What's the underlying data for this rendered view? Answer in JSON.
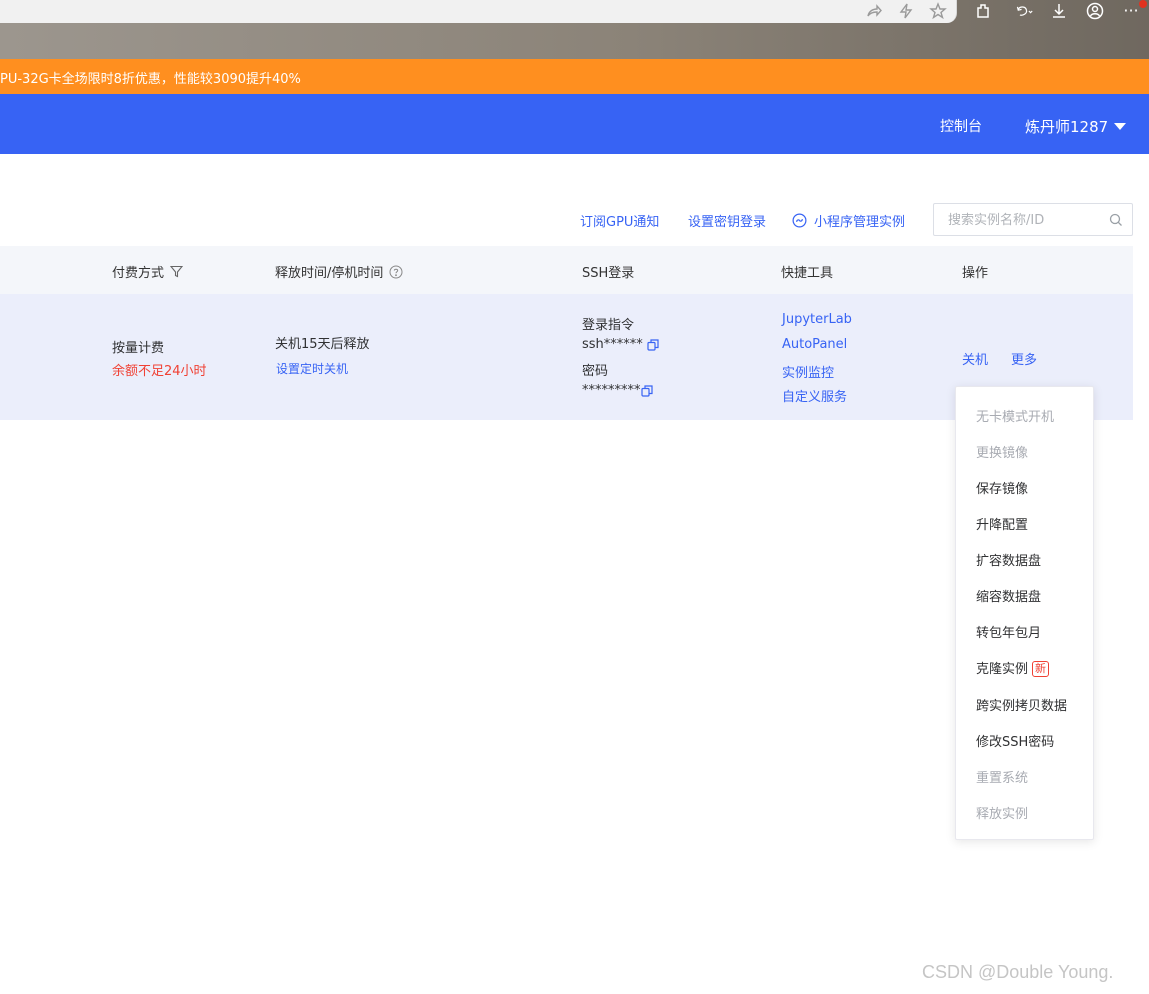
{
  "browser": {
    "icons": [
      "share-icon",
      "bolt-icon",
      "star-icon",
      "extensions-icon",
      "undo-icon",
      "download-icon",
      "profile-icon",
      "more-icon"
    ],
    "more_label": "···"
  },
  "promo": {
    "text": "PU-32G卡全场限时8折优惠，性能较3090提升40%"
  },
  "header": {
    "console": "控制台",
    "user": "炼丹师1287"
  },
  "toolbar": {
    "subscribe": "订阅GPU通知",
    "ssh_key": "设置密钥登录",
    "miniprogram": "小程序管理实例",
    "search_placeholder": "搜索实例名称/ID"
  },
  "table": {
    "headers": {
      "billing": "付费方式",
      "release": "释放时间/停机时间",
      "ssh": "SSH登录",
      "tools": "快捷工具",
      "ops": "操作"
    },
    "row": {
      "billing_mode": "按量计费",
      "billing_warning": "余额不足24小时",
      "release_text": "关机15天后释放",
      "release_link": "设置定时关机",
      "ssh_cmd_label": "登录指令",
      "ssh_cmd": "ssh******",
      "password_label": "密码",
      "password": "*********",
      "tools": [
        "JupyterLab",
        "AutoPanel",
        "实例监控",
        "自定义服务"
      ],
      "op_shutdown": "关机",
      "op_more": "更多"
    }
  },
  "dropdown": {
    "items": [
      {
        "label": "无卡模式开机",
        "disabled": true
      },
      {
        "label": "更换镜像",
        "disabled": true
      },
      {
        "label": "保存镜像",
        "disabled": false
      },
      {
        "label": "升降配置",
        "disabled": false
      },
      {
        "label": "扩容数据盘",
        "disabled": false
      },
      {
        "label": "缩容数据盘",
        "disabled": false
      },
      {
        "label": "转包年包月",
        "disabled": false
      },
      {
        "label": "克隆实例",
        "disabled": false,
        "badge": "新"
      },
      {
        "label": "跨实例拷贝数据",
        "disabled": false
      },
      {
        "label": "修改SSH密码",
        "disabled": false
      },
      {
        "label": "重置系统",
        "disabled": true
      },
      {
        "label": "释放实例",
        "disabled": true
      }
    ]
  },
  "watermark": "CSDN @Double Young.",
  "colors": {
    "primary": "#3763f4",
    "promo": "#ff8f1f",
    "warning": "#f04134",
    "row_bg": "#ebeefb",
    "header_bg": "#f4f6fa"
  }
}
